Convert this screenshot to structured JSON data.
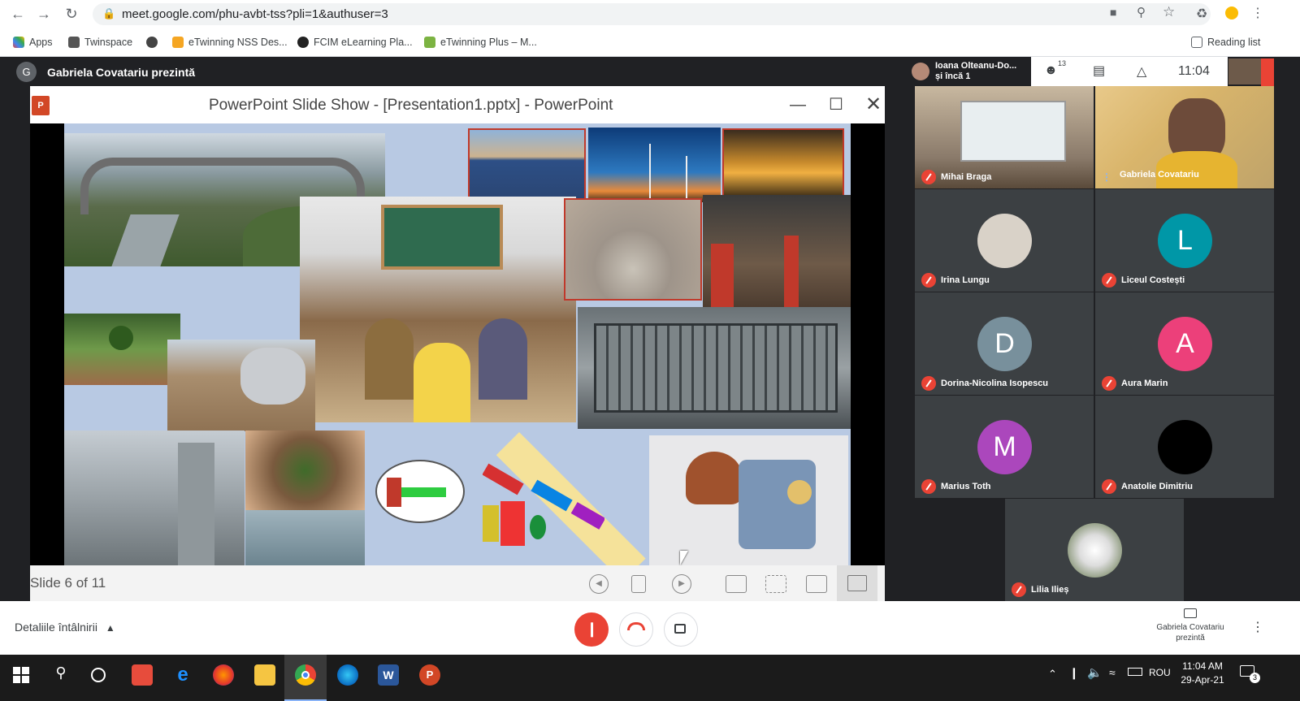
{
  "browser": {
    "url": "meet.google.com/phu-avbt-tss?pli=1&authuser=3",
    "bookmarks": [
      "Apps",
      "Twinspace",
      "eTwinning NSS Des...",
      "FCIM eLearning Pla...",
      "eTwinning Plus – M..."
    ],
    "reading_list": "Reading list"
  },
  "meet": {
    "presenter_initial": "G",
    "presenter_label": "Gabriela Covatariu prezintă",
    "meeting_people": "Ioana Olteanu-Do...",
    "meeting_people_more": "și încă 1",
    "participants_count": "13",
    "time": "11:04",
    "details_label": "Detaliile întâlnirii",
    "presenting_label_1": "Gabriela Covatariu",
    "presenting_label_2": "prezintă"
  },
  "ppt": {
    "window_title": "PowerPoint Slide Show - [Presentation1.pptx] - PowerPoint",
    "slide_counter": "Slide 6 of 11"
  },
  "participants": [
    {
      "name": "Mihai Braga",
      "muted": true
    },
    {
      "name": "Gabriela Covatariu",
      "muted": false
    },
    {
      "name": "Irina Lungu",
      "muted": true
    },
    {
      "name": "Liceul Costești",
      "initial": "L",
      "color": "#0097a7",
      "muted": true
    },
    {
      "name": "Dorina-Nicolina Isopescu",
      "initial": "D",
      "color": "#78909c",
      "muted": true
    },
    {
      "name": "Aura Marin",
      "initial": "A",
      "color": "#ec407a",
      "muted": true
    },
    {
      "name": "Marius Toth",
      "initial": "M",
      "color": "#ab47bc",
      "muted": true
    },
    {
      "name": "Anatolie Dimitriu",
      "muted": true
    },
    {
      "name": "Lilia Ilieș",
      "muted": true
    }
  ],
  "taskbar": {
    "language": "ROU",
    "clock_time": "11:04 AM",
    "clock_date": "29-Apr-21",
    "notifications": "3"
  }
}
